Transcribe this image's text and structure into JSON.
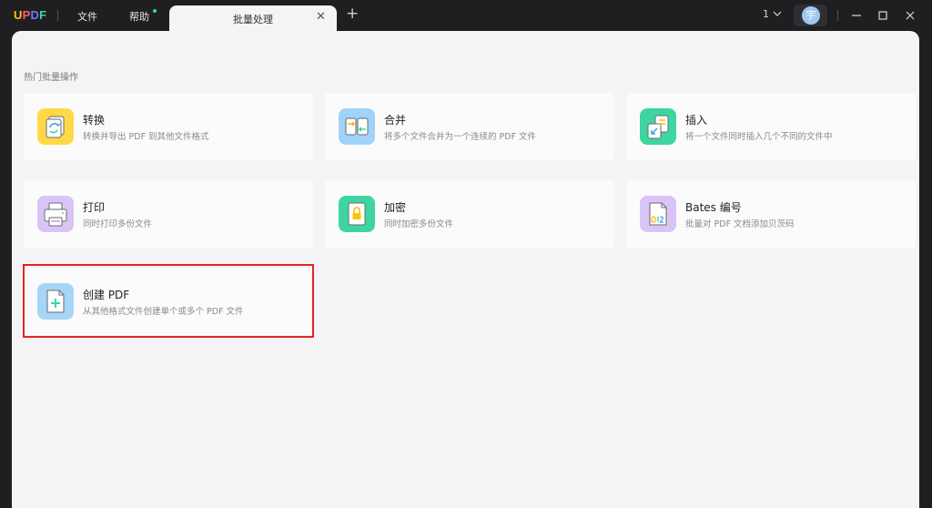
{
  "titlebar": {
    "logo": {
      "u": "U",
      "p": "P",
      "d": "D",
      "f": "F"
    },
    "menus": [
      "文件",
      "帮助"
    ],
    "tab": {
      "label": "批量处理",
      "close": "✕"
    },
    "add_tab": "+",
    "page_number": "1",
    "avatar_initial": "宇"
  },
  "section": {
    "title": "热门批量操作"
  },
  "cards": [
    {
      "title": "转换",
      "desc": "转换并导出 PDF 到其他文件格式",
      "icon": "convert-icon",
      "color": "#ffd84a"
    },
    {
      "title": "合并",
      "desc": "将多个文件合并为一个连续的 PDF 文件",
      "icon": "merge-icon",
      "color": "#9fd3f7"
    },
    {
      "title": "插入",
      "desc": "将一个文件同时插入几个不同的文件中",
      "icon": "insert-icon",
      "color": "#3ed6a0"
    },
    {
      "title": "打印",
      "desc": "同时打印多份文件",
      "icon": "print-icon",
      "color": "#d9c4f6"
    },
    {
      "title": "加密",
      "desc": "同时加密多份文件",
      "icon": "lock-icon",
      "color": "#3ed6a0"
    },
    {
      "title": "Bates 编号",
      "desc": "批量对 PDF 文档添加贝茨码",
      "icon": "bates-number-icon",
      "color": "#d9c4f6"
    },
    {
      "title": "创建 PDF",
      "desc": "从其他格式文件创建单个或多个 PDF 文件",
      "icon": "create-pdf-icon",
      "color": "#a6d6f7"
    }
  ],
  "colors": {
    "accent_green": "#3ed6a0",
    "highlight_red": "#e02424",
    "titlebar_bg": "#1f1f22",
    "content_bg": "#f4f4f6"
  }
}
